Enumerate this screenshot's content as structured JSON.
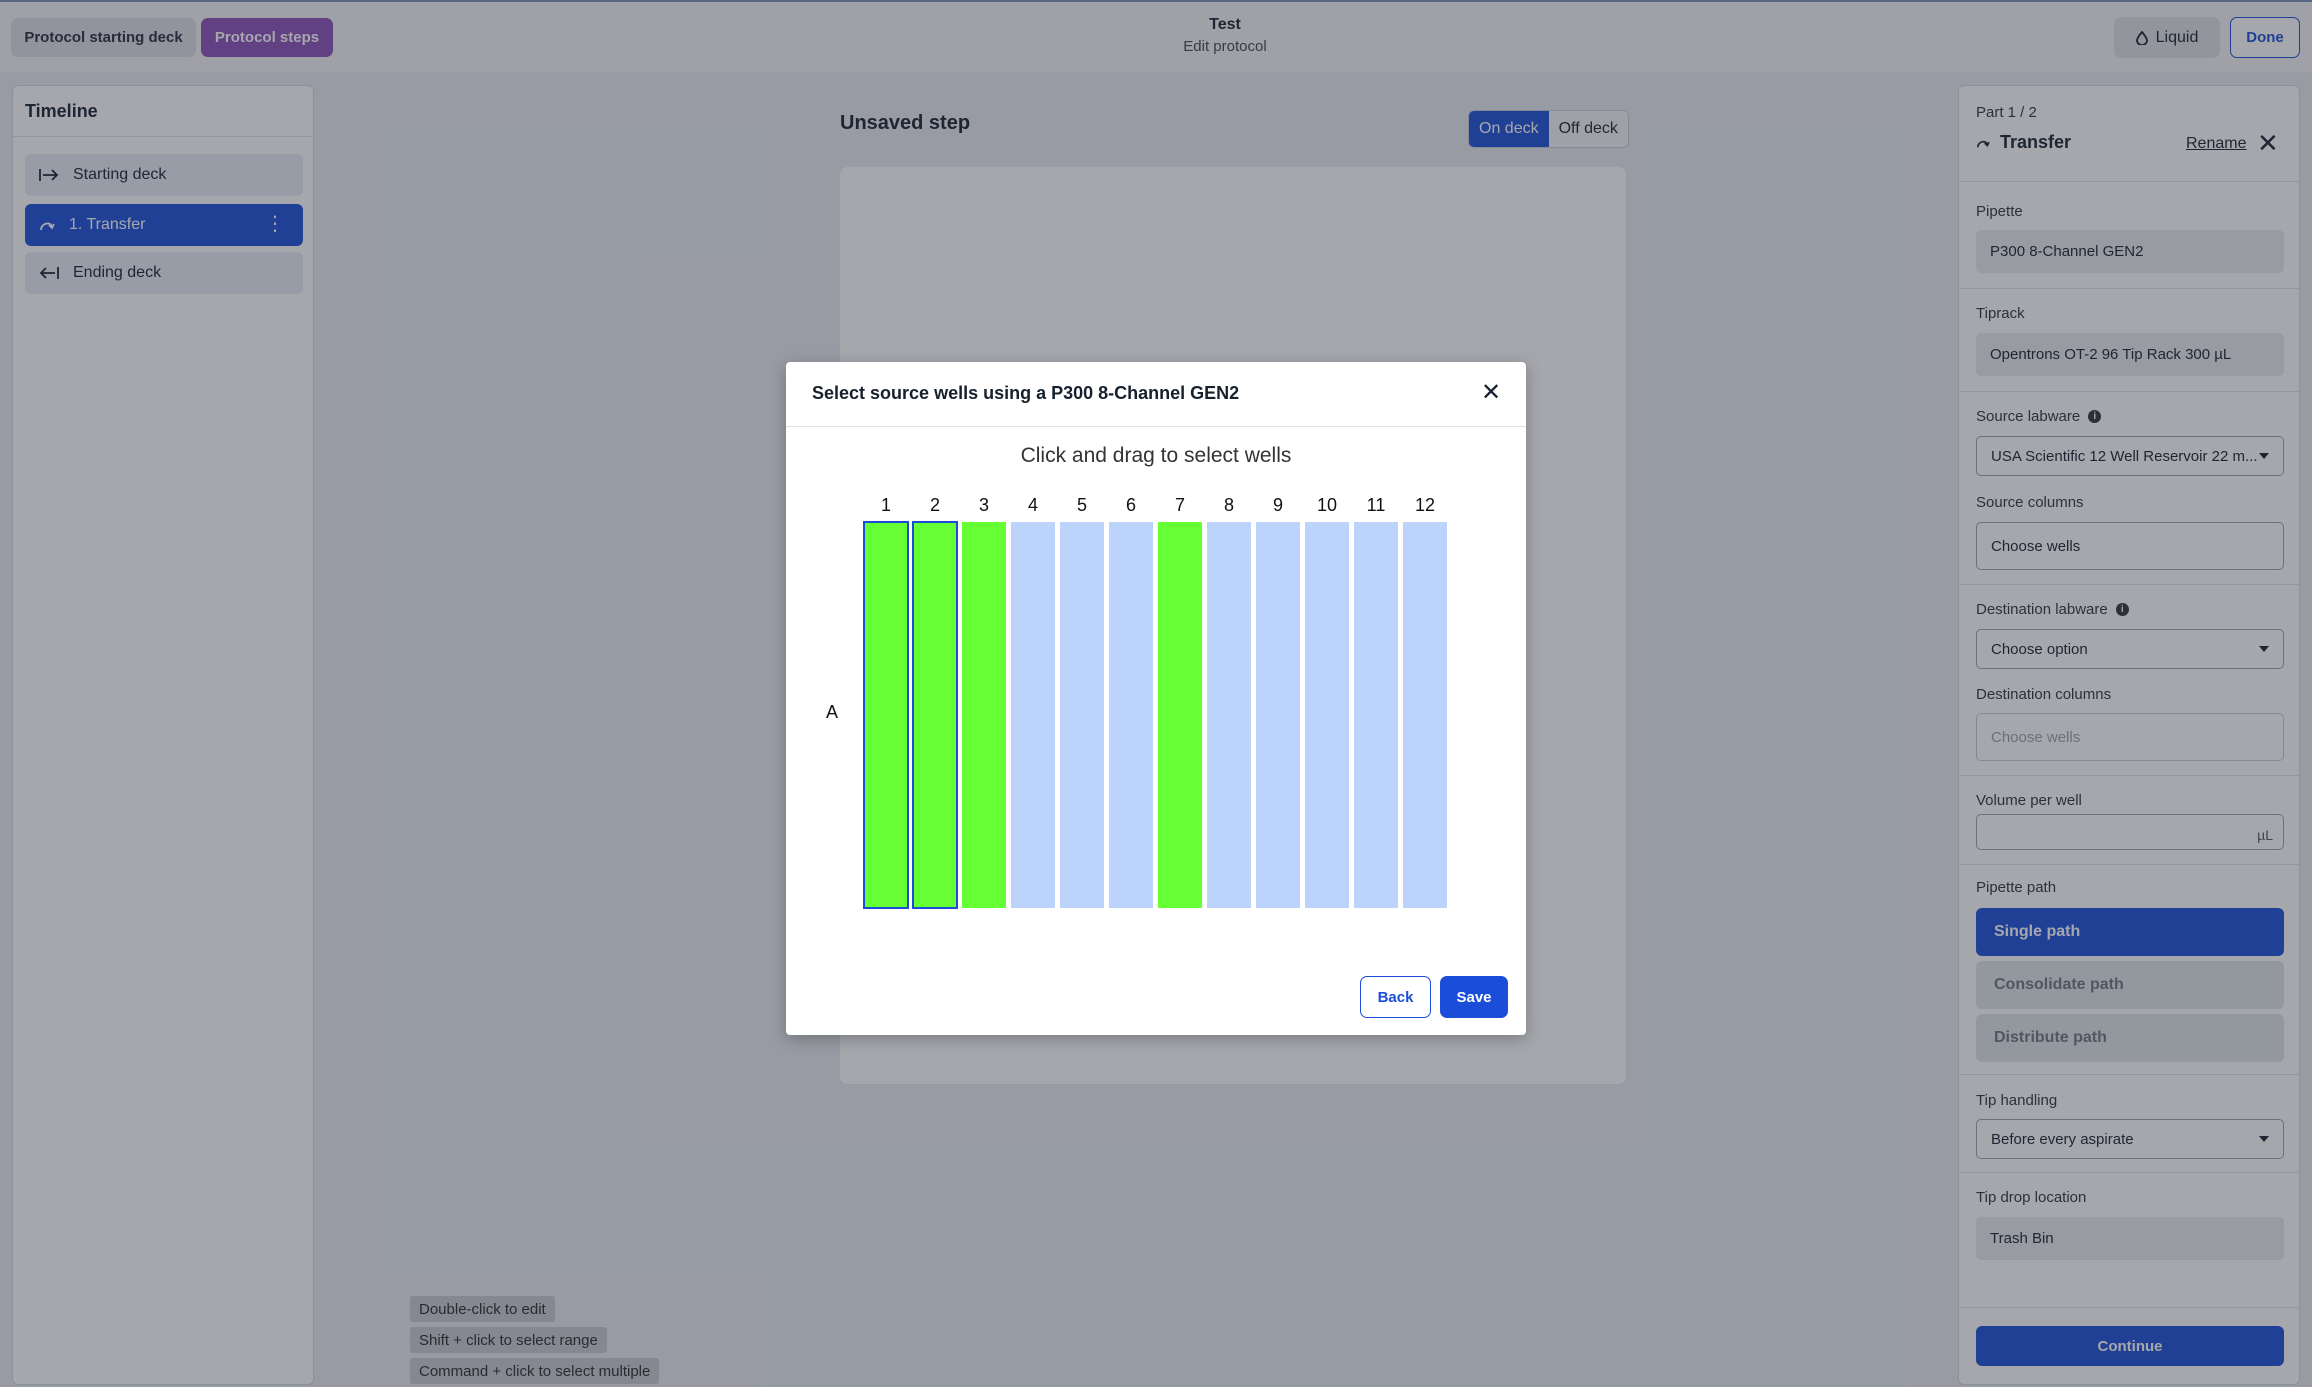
{
  "header": {
    "tab_starting_deck": "Protocol starting deck",
    "tab_steps": "Protocol steps",
    "title": "Test",
    "subtitle": "Edit protocol",
    "liquid_label": "Liquid",
    "done_label": "Done"
  },
  "timeline": {
    "heading": "Timeline",
    "items": [
      {
        "label": "Starting deck",
        "icon": "arrow-right-bar-icon"
      },
      {
        "label": "1. Transfer",
        "icon": "transfer-icon",
        "active": true
      },
      {
        "label": "Ending deck",
        "icon": "arrow-left-bar-icon"
      }
    ]
  },
  "main": {
    "title": "Unsaved step",
    "deck_toggle": [
      "On deck",
      "Off deck"
    ],
    "hints": [
      "Double-click to edit",
      "Shift + click to select range",
      "Command + click to select multiple"
    ]
  },
  "form": {
    "part": "Part 1 / 2",
    "title": "Transfer",
    "rename": "Rename",
    "pipette_label": "Pipette",
    "pipette_value": "P300 8-Channel GEN2",
    "tiprack_label": "Tiprack",
    "tiprack_value": "Opentrons OT-2 96 Tip Rack 300 µL",
    "source_labware_label": "Source labware",
    "source_labware_value": "USA Scientific 12 Well Reservoir 22 m...",
    "source_columns_label": "Source columns",
    "source_columns_value": "Choose wells",
    "dest_labware_label": "Destination labware",
    "dest_labware_value": "Choose option",
    "dest_columns_label": "Destination columns",
    "dest_columns_placeholder": "Choose wells",
    "volume_label": "Volume per well",
    "volume_unit": "µL",
    "pipette_path_label": "Pipette path",
    "paths": [
      "Single path",
      "Consolidate path",
      "Distribute path"
    ],
    "tip_handling_label": "Tip handling",
    "tip_handling_value": "Before every aspirate",
    "tip_drop_label": "Tip drop location",
    "tip_drop_value": "Trash Bin",
    "continue_label": "Continue"
  },
  "modal": {
    "title": "Select source wells using a P300 8-Channel GEN2",
    "instruction": "Click and drag to select wells",
    "row_label": "A",
    "columns": [
      "1",
      "2",
      "3",
      "4",
      "5",
      "6",
      "7",
      "8",
      "9",
      "10",
      "11",
      "12"
    ],
    "selected_columns": [
      1,
      2,
      3,
      7
    ],
    "focused_columns": [
      1,
      2
    ],
    "back_label": "Back",
    "save_label": "Save",
    "colors": {
      "selected": "#66ff33",
      "empty": "#bcd3fb",
      "focus": "#1b4ed8"
    }
  }
}
